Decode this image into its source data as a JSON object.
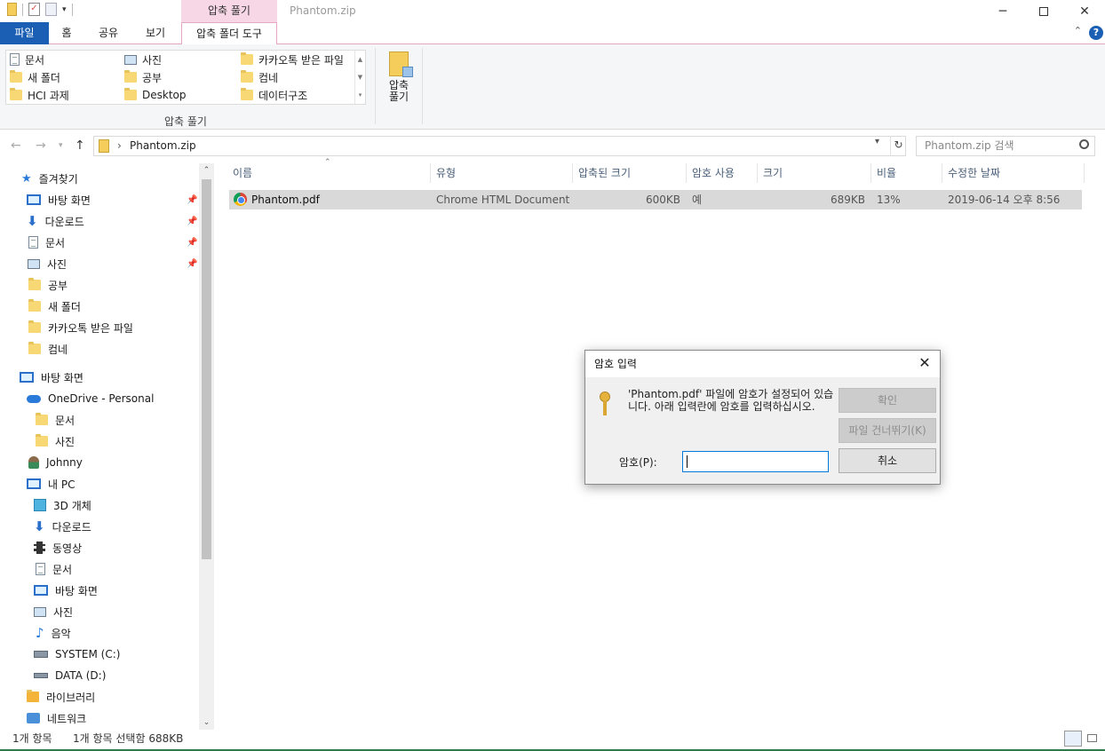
{
  "window": {
    "context_tab": "압축 풀기",
    "title": "Phantom.zip"
  },
  "ribbon_tabs": {
    "file": "파일",
    "home": "홈",
    "share": "공유",
    "view": "보기",
    "tools": "압축 폴더 도구"
  },
  "ribbon": {
    "gallery": [
      "문서",
      "사진",
      "카카오톡 받은 파일",
      "새 폴더",
      "공부",
      "컴네",
      "HCI 과제",
      "Desktop",
      "데이터구조"
    ],
    "group_label": "압축 풀기",
    "extract_all": "압축\n풀기"
  },
  "address": {
    "crumb": "Phantom.zip",
    "search_placeholder": "Phantom.zip 검색"
  },
  "nav": {
    "quick_access": "즐겨찾기",
    "quick_items": [
      "바탕 화면",
      "다운로드",
      "문서",
      "사진",
      "공부",
      "새 폴더",
      "카카오톡 받은 파일",
      "컴네"
    ],
    "desktop": "바탕 화면",
    "onedrive": "OneDrive - Personal",
    "onedrive_items": [
      "문서",
      "사진"
    ],
    "user": "Johnny",
    "pc": "내 PC",
    "pc_items": [
      "3D 개체",
      "다운로드",
      "동영상",
      "문서",
      "바탕 화면",
      "사진",
      "음악",
      "SYSTEM (C:)",
      "DATA (D:)"
    ],
    "libraries": "라이브러리",
    "network": "네트워크"
  },
  "columns": [
    "이름",
    "유형",
    "압축된 크기",
    "암호 사용",
    "크기",
    "비율",
    "수정한 날짜"
  ],
  "files": [
    {
      "name": "Phantom.pdf",
      "type": "Chrome HTML Document",
      "packed": "600KB",
      "encrypted": "예",
      "size": "689KB",
      "ratio": "13%",
      "modified": "2019-06-14 오후 8:56"
    }
  ],
  "status": {
    "count": "1개 항목",
    "selected": "1개 항목 선택함 688KB"
  },
  "dialog": {
    "title": "암호 입력",
    "message": "'Phantom.pdf' 파일에 암호가 설정되어 있습니다. 아래 입력란에 암호를 입력하십시오.",
    "ok": "확인",
    "skip": "파일 건너뛰기(K)",
    "cancel": "취소",
    "pw_label": "암호(P):",
    "pw_value": ""
  }
}
